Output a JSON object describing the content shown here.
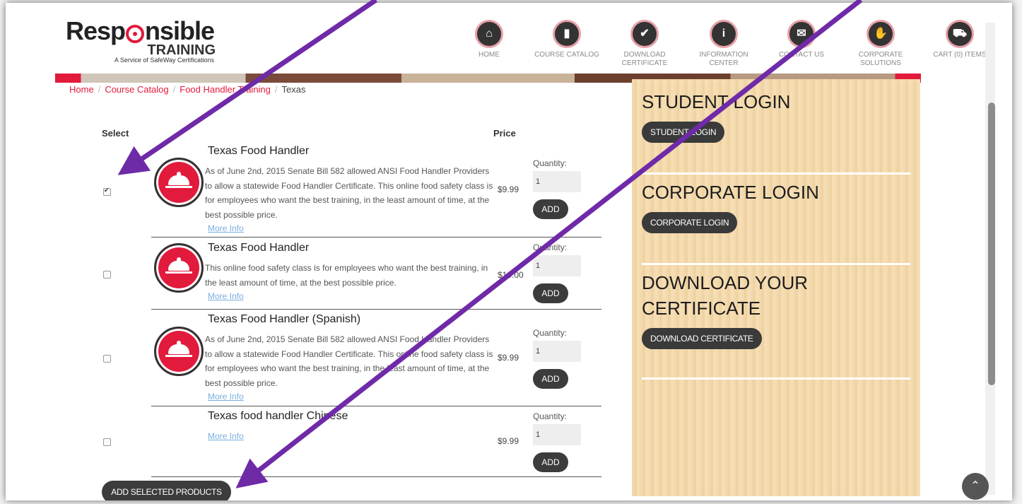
{
  "logo": {
    "main_left": "Resp",
    "main_right": "nsible",
    "sub": "TRAINING",
    "tagline": "A Service of SafeWay Certifications"
  },
  "nav": [
    {
      "label": "HOME",
      "icon": "home-icon",
      "glyph": "⌂"
    },
    {
      "label": "COURSE CATALOG",
      "icon": "book-icon",
      "glyph": "▮"
    },
    {
      "label": "DOWNLOAD CERTIFICATE",
      "icon": "shield-check-icon",
      "glyph": "✔"
    },
    {
      "label": "INFORMATION CENTER",
      "icon": "info-icon",
      "glyph": "i"
    },
    {
      "label": "CONTACT US",
      "icon": "envelope-icon",
      "glyph": "✉"
    },
    {
      "label": "CORPORATE SOLUTIONS",
      "icon": "handshake-icon",
      "glyph": "✋"
    },
    {
      "label": "CART (0) ITEMS",
      "icon": "cart-icon",
      "glyph": "⛟"
    }
  ],
  "breadcrumb": {
    "home": "Home",
    "catalog": "Course Catalog",
    "category": "Food Handler Training",
    "current": "Texas",
    "separator": "/"
  },
  "table": {
    "select_header": "Select",
    "price_header": "Price"
  },
  "products": [
    {
      "title": "Texas Food Handler",
      "desc": "As of June 2nd, 2015 Senate Bill 582 allowed ANSI Food Handler Providers to allow a statewide Food Handler Certificate. This online food safety class is for employees who want the best training, in the least amount of time, at the best possible price.",
      "more": "More Info",
      "price": "$9.99",
      "qty_label": "Quantity:",
      "qty": "1",
      "add": "ADD",
      "checked": true
    },
    {
      "title": "Texas Food Handler",
      "desc": "This online food safety class is for employees who want the best training, in the least amount of time, at the best possible price.",
      "more": "More Info",
      "price": "$10.00",
      "qty_label": "Quantity:",
      "qty": "1",
      "add": "ADD",
      "checked": false
    },
    {
      "title": "Texas Food Handler (Spanish)",
      "desc": "As of June 2nd, 2015 Senate Bill 582 allowed ANSI Food Handler Providers to allow a statewide Food Handler Certificate. This online food safety class is for employees who want the best training, in the least amount of time, at the best possible price.",
      "more": "More Info",
      "price": "$9.99",
      "qty_label": "Quantity:",
      "qty": "1",
      "add": "ADD",
      "checked": false
    },
    {
      "title": "Texas food handler Chinese",
      "desc": "",
      "more": "More Info",
      "price": "$9.99",
      "qty_label": "Quantity:",
      "qty": "1",
      "add": "ADD",
      "checked": false
    }
  ],
  "add_selected": "ADD SELECTED PRODUCTS",
  "sidebar": {
    "student": {
      "title": "STUDENT LOGIN",
      "button": "STUDENT LOGIN"
    },
    "corporate": {
      "title": "CORPORATE LOGIN",
      "button": "CORPORATE LOGIN"
    },
    "download": {
      "title": "DOWNLOAD YOUR CERTIFICATE",
      "button": "DOWNLOAD CERTIFICATE"
    }
  },
  "scroll_top": "⌃",
  "colors": {
    "brand_red": "#e21a3c",
    "annotation_purple": "#6f2aa8",
    "wood": "#f3d9ad"
  }
}
